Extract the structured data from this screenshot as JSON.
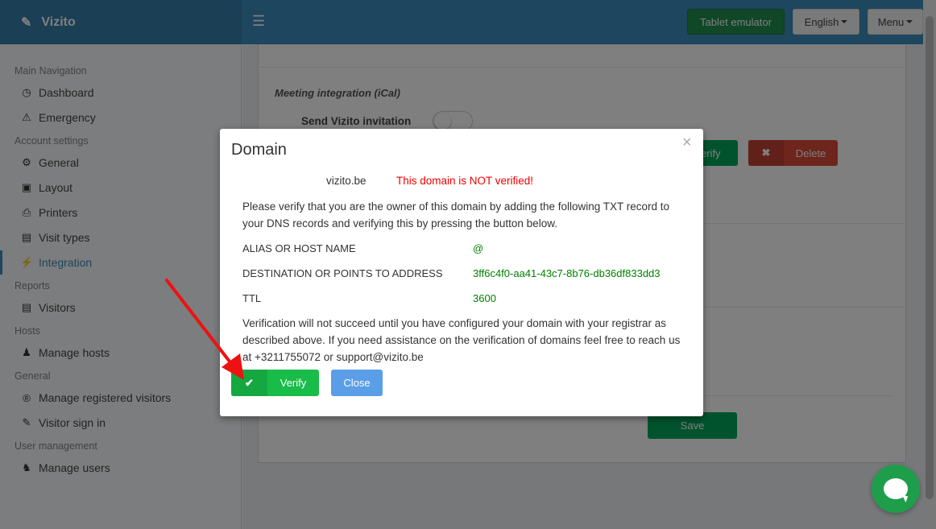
{
  "app": {
    "brand": "Vizito"
  },
  "topbar": {
    "tablet_label": "Tablet emulator",
    "language_label": "English",
    "menu_label": "Menu"
  },
  "sidebar": {
    "sections": [
      {
        "title": "Main Navigation"
      },
      {
        "title": "Account settings"
      },
      {
        "title": "Reports"
      },
      {
        "title": "Hosts"
      },
      {
        "title": "General"
      },
      {
        "title": "User management"
      }
    ],
    "items": [
      {
        "label": "Dashboard",
        "icon": "dashboard-icon"
      },
      {
        "label": "Emergency",
        "icon": "warning-icon"
      },
      {
        "label": "General",
        "icon": "gear-icon"
      },
      {
        "label": "Layout",
        "icon": "image-icon"
      },
      {
        "label": "Printers",
        "icon": "printer-icon"
      },
      {
        "label": "Visit types",
        "icon": "briefcase-icon"
      },
      {
        "label": "Integration",
        "icon": "plug-icon",
        "active": true
      },
      {
        "label": "Visitors",
        "icon": "briefcase-icon"
      },
      {
        "label": "Manage hosts",
        "icon": "person-icon"
      },
      {
        "label": "Manage registered visitors",
        "icon": "registered-icon"
      },
      {
        "label": "Visitor sign in",
        "icon": "pencil-icon"
      },
      {
        "label": "Manage users",
        "icon": "user-plus-icon"
      }
    ]
  },
  "background": {
    "ical_title": "Meeting integration (iCal)",
    "invite_label": "Send Vizito invitation",
    "verify_partial": "erify",
    "delete_label": "Delete",
    "save_label": "Save"
  },
  "modal": {
    "title": "Domain",
    "close_symbol": "×",
    "domain": "vizito.be",
    "status": "This domain is NOT verified!",
    "intro": "Please verify that you are the owner of this domain by adding the following TXT record to your DNS records and verifying this by pressing the button below.",
    "records": [
      {
        "label": "ALIAS OR HOST NAME",
        "value": "@"
      },
      {
        "label": "DESTINATION OR POINTS TO ADDRESS",
        "value": "3ff6c4f0-aa41-43c7-8b76-db36df833dd3"
      },
      {
        "label": "TTL",
        "value": "3600"
      }
    ],
    "note": "Verification will not succeed until you have configured your domain with your registrar as described above. If you need assistance on the verification of domains feel free to reach us at +3211755072 or support@vizito.be",
    "verify_label": "Verify",
    "close_label": "Close"
  },
  "colors": {
    "topbar": "#3c8dbc",
    "verify_green": "#18bc48",
    "status_red": "#e00",
    "record_value_green": "#008000",
    "close_blue": "#5a9ee8",
    "arrow_red": "#ee1111"
  }
}
